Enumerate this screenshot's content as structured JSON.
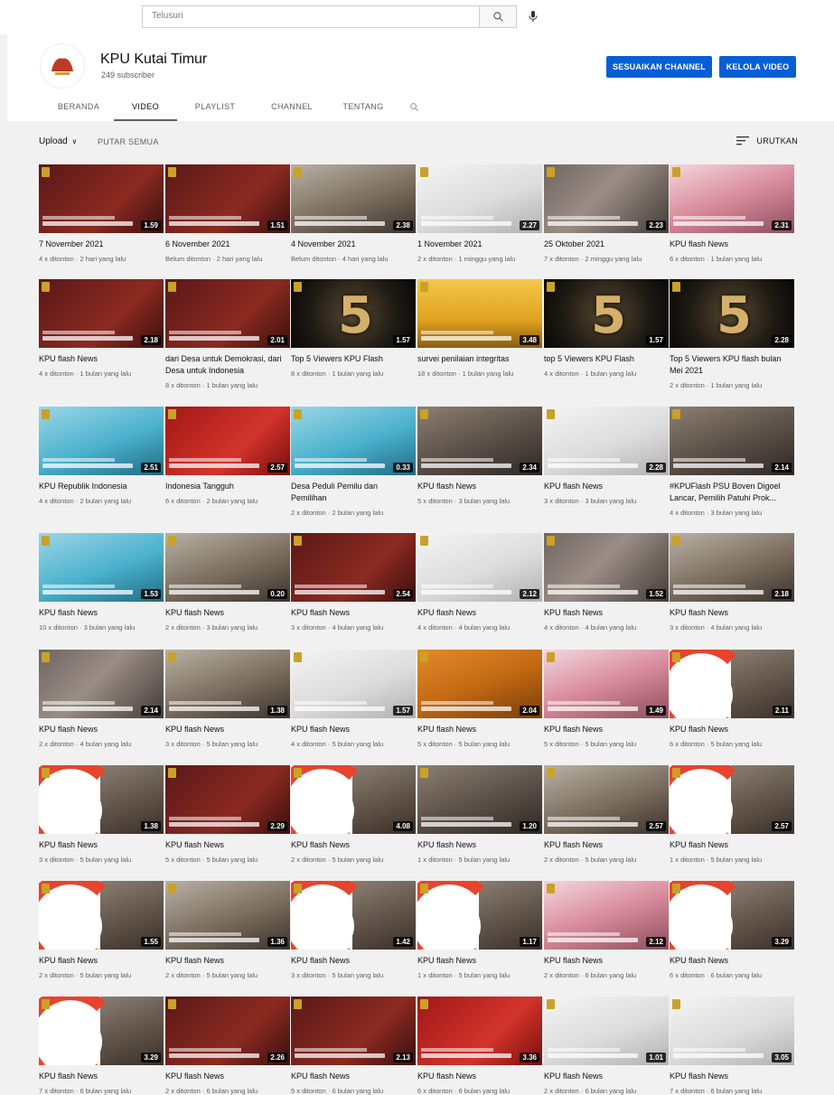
{
  "search": {
    "placeholder": "Telusuri"
  },
  "channel": {
    "name": "KPU Kutai Timur",
    "subscribers": "249 subscriber",
    "customize_label": "SESUAIKAN CHANNEL",
    "manage_label": "KELOLA VIDEO"
  },
  "tabs": [
    "BERANDA",
    "VIDEO",
    "PLAYLIST",
    "CHANNEL",
    "TENTANG"
  ],
  "controls": {
    "upload": "Upload",
    "play_all": "PUTAR SEMUA",
    "sort": "URUTKAN"
  },
  "colors": {
    "primary_button": "#065fd4",
    "background": "#f1f1f1"
  },
  "videos": [
    {
      "title": "7 November 2021",
      "meta": "4 x ditonton · 2 hari yang lalu",
      "duration": "1.59",
      "theme": "t-maroon"
    },
    {
      "title": "6 November 2021",
      "meta": "Belum ditonton · 2 hari yang lalu",
      "duration": "1.51",
      "theme": "t-maroon"
    },
    {
      "title": "4 November 2021",
      "meta": "Belum ditonton · 4 hari yang lalu",
      "duration": "2.38",
      "theme": "t-office"
    },
    {
      "title": "1 November 2021",
      "meta": "2 x ditonton · 1 minggu yang lalu",
      "duration": "2.27",
      "theme": "t-white"
    },
    {
      "title": "25 Oktober 2021",
      "meta": "7 x ditonton · 2 minggu yang lalu",
      "duration": "2.23",
      "theme": "t-mixed"
    },
    {
      "title": "KPU flash News",
      "meta": "6 x ditonton · 1 bulan yang lalu",
      "duration": "2.31",
      "theme": "t-pink"
    },
    {
      "title": "KPU flash News",
      "meta": "4 x ditonton · 1 bulan yang lalu",
      "duration": "2.18",
      "theme": "t-maroon"
    },
    {
      "title": "dari Desa untuk Demokrasi, dari Desa untuk Indonesia",
      "meta": "8 x ditonton · 1 bulan yang lalu",
      "duration": "2.01",
      "theme": "t-maroon"
    },
    {
      "title": "Top 5 Viewers KPU Flash",
      "meta": "8 x ditonton · 1 bulan yang lalu",
      "duration": "1.57",
      "theme": "t-five"
    },
    {
      "title": "survei penilaian integritas",
      "meta": "18 x ditonton · 1 bulan yang lalu",
      "duration": "3.48",
      "theme": "t-cartoon"
    },
    {
      "title": "top 5 Viewers KPU Flash",
      "meta": "4 x ditonton · 1 bulan yang lalu",
      "duration": "1.57",
      "theme": "t-five"
    },
    {
      "title": "Top 5 Viewers KPU flash bulan Mei 2021",
      "meta": "2 x ditonton · 1 bulan yang lalu",
      "duration": "2.28",
      "theme": "t-five"
    },
    {
      "title": "KPU Republik Indonesia",
      "meta": "4 x ditonton · 2 bulan yang lalu",
      "duration": "2.51",
      "theme": "t-teal"
    },
    {
      "title": "Indonesia Tangguh",
      "meta": "6 x ditonton · 2 bulan yang lalu",
      "duration": "2.57",
      "theme": "t-red"
    },
    {
      "title": "Desa Peduli Pemilu dan Pemilihan",
      "meta": "2 x ditonton · 2 bulan yang lalu",
      "duration": "0.33",
      "theme": "t-teal"
    },
    {
      "title": "KPU flash News",
      "meta": "5 x ditonton · 3 bulan yang lalu",
      "duration": "2.34",
      "theme": "t-street"
    },
    {
      "title": "KPU flash News",
      "meta": "3 x ditonton · 3 bulan yang lalu",
      "duration": "2.28",
      "theme": "t-white"
    },
    {
      "title": "#KPUFlash PSU Boven Digoel Lancar, Pemilih Patuhi Prok...",
      "meta": "4 x ditonton · 3 bulan yang lalu",
      "duration": "2.14",
      "theme": "t-street"
    },
    {
      "title": "KPU flash News",
      "meta": "10 x ditonton · 3 bulan yang lalu",
      "duration": "1.53",
      "theme": "t-teal"
    },
    {
      "title": "KPU flash News",
      "meta": "2 x ditonton · 3 bulan yang lalu",
      "duration": "0.20",
      "theme": "t-office"
    },
    {
      "title": "KPU flash News",
      "meta": "3 x ditonton · 4 bulan yang lalu",
      "duration": "2.54",
      "theme": "t-maroon"
    },
    {
      "title": "KPU flash News",
      "meta": "4 x ditonton · 4 bulan yang lalu",
      "duration": "2.12",
      "theme": "t-white"
    },
    {
      "title": "KPU flash News",
      "meta": "4 x ditonton · 4 bulan yang lalu",
      "duration": "1.52",
      "theme": "t-mixed"
    },
    {
      "title": "KPU flash News",
      "meta": "3 x ditonton · 4 bulan yang lalu",
      "duration": "2.18",
      "theme": "t-office"
    },
    {
      "title": "KPU flash News",
      "meta": "2 x ditonton · 4 bulan yang lalu",
      "duration": "2.14",
      "theme": "t-mixed"
    },
    {
      "title": "KPU flash News",
      "meta": "3 x ditonton · 5 bulan yang lalu",
      "duration": "1.38",
      "theme": "t-office"
    },
    {
      "title": "KPU flash News",
      "meta": "4 x ditonton · 5 bulan yang lalu",
      "duration": "1.57",
      "theme": "t-white"
    },
    {
      "title": "KPU flash News",
      "meta": "5 x ditonton · 5 bulan yang lalu",
      "duration": "2.04",
      "theme": "t-tps"
    },
    {
      "title": "KPU flash News",
      "meta": "5 x ditonton · 5 bulan yang lalu",
      "duration": "1.49",
      "theme": "t-pink"
    },
    {
      "title": "KPU flash News",
      "meta": "6 x ditonton · 5 bulan yang lalu",
      "duration": "2.11",
      "theme": "t-swirl"
    },
    {
      "title": "KPU flash News",
      "meta": "3 x ditonton · 5 bulan yang lalu",
      "duration": "1.38",
      "theme": "t-swirl"
    },
    {
      "title": "KPU flash News",
      "meta": "5 x ditonton · 5 bulan yang lalu",
      "duration": "2.29",
      "theme": "t-maroon"
    },
    {
      "title": "KPU flash News",
      "meta": "2 x ditonton · 5 bulan yang lalu",
      "duration": "4.08",
      "theme": "t-swirl"
    },
    {
      "title": "KPU flash News",
      "meta": "1 x ditonton · 5 bulan yang lalu",
      "duration": "1.20",
      "theme": "t-street"
    },
    {
      "title": "KPU flash News",
      "meta": "2 x ditonton · 5 bulan yang lalu",
      "duration": "2.57",
      "theme": "t-office"
    },
    {
      "title": "KPU flash News",
      "meta": "1 x ditonton · 5 bulan yang lalu",
      "duration": "2.57",
      "theme": "t-swirl"
    },
    {
      "title": "KPU flash News",
      "meta": "2 x ditonton · 5 bulan yang lalu",
      "duration": "1.55",
      "theme": "t-swirl"
    },
    {
      "title": "KPU flash News",
      "meta": "2 x ditonton · 5 bulan yang lalu",
      "duration": "1.36",
      "theme": "t-office"
    },
    {
      "title": "KPU flash News",
      "meta": "3 x ditonton · 5 bulan yang lalu",
      "duration": "1.42",
      "theme": "t-swirl"
    },
    {
      "title": "KPU flash News",
      "meta": "1 x ditonton · 5 bulan yang lalu",
      "duration": "1.17",
      "theme": "t-swirl"
    },
    {
      "title": "KPU flash News",
      "meta": "2 x ditonton · 6 bulan yang lalu",
      "duration": "2.12",
      "theme": "t-pink"
    },
    {
      "title": "KPU flash News",
      "meta": "6 x ditonton · 6 bulan yang lalu",
      "duration": "3.29",
      "theme": "t-swirl"
    },
    {
      "title": "KPU flash News",
      "meta": "7 x ditonton · 6 bulan yang lalu",
      "duration": "3.29",
      "theme": "t-swirl"
    },
    {
      "title": "KPU flash News",
      "meta": "2 x ditonton · 6 bulan yang lalu",
      "duration": "2.26",
      "theme": "t-maroon"
    },
    {
      "title": "KPU flash News",
      "meta": "5 x ditonton · 6 bulan yang lalu",
      "duration": "2.13",
      "theme": "t-maroon"
    },
    {
      "title": "KPU flash News",
      "meta": "6 x ditonton · 6 bulan yang lalu",
      "duration": "3.36",
      "theme": "t-red"
    },
    {
      "title": "KPU flash News",
      "meta": "2 x ditonton · 6 bulan yang lalu",
      "duration": "1.01",
      "theme": "t-white"
    },
    {
      "title": "KPU flash News",
      "meta": "7 x ditonton · 6 bulan yang lalu",
      "duration": "3.05",
      "theme": "t-white"
    }
  ]
}
